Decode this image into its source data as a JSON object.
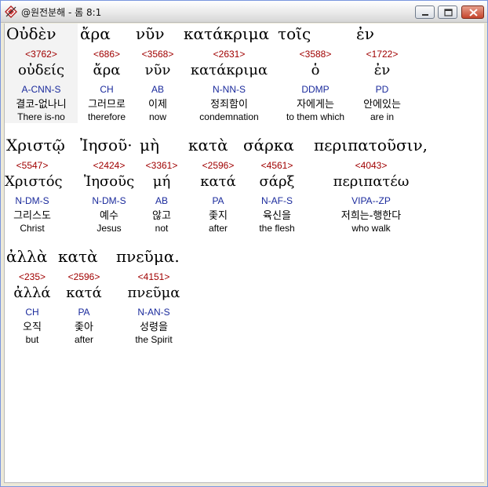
{
  "window": {
    "title": "@원전분해 - 롬 8:1",
    "icon": "app-logo-icon",
    "buttons": [
      "minimize-icon",
      "maximize-icon",
      "close-icon"
    ]
  },
  "words": [
    {
      "greek": "Οὐδὲν",
      "strong": "<3762>",
      "lemma": "οὐδείς",
      "morph": "A-CNN-S",
      "korean": "결코-없나니",
      "english": "There is-no"
    },
    {
      "greek": "ἄρα",
      "strong": "<686>",
      "lemma": "ἄρα",
      "morph": "CH",
      "korean": "그러므로",
      "english": "therefore"
    },
    {
      "greek": "νῦν",
      "strong": "<3568>",
      "lemma": "νῦν",
      "morph": "AB",
      "korean": "이제",
      "english": "now"
    },
    {
      "greek": "κατάκριμα",
      "strong": "<2631>",
      "lemma": "κατάκριμα",
      "morph": "N-NN-S",
      "korean": "정죄함이",
      "english": "condemnation"
    },
    {
      "greek": "τοῖς",
      "strong": "<3588>",
      "lemma": "ὁ",
      "morph": "DDMP",
      "korean": "자에게는",
      "english": "to them which"
    },
    {
      "greek": "ἐν",
      "strong": "<1722>",
      "lemma": "ἐν",
      "morph": "PD",
      "korean": "안에있는",
      "english": "are in"
    },
    {
      "greek": "Χριστῷ",
      "strong": "<5547>",
      "lemma": "Χριστός",
      "morph": "N-DM-S",
      "korean": "그리스도",
      "english": "Christ"
    },
    {
      "greek": "Ἰησοῦ·",
      "strong": "<2424>",
      "lemma": "Ἰησοῦς",
      "morph": "N-DM-S",
      "korean": "예수",
      "english": "Jesus"
    },
    {
      "greek": "μὴ",
      "strong": "<3361>",
      "lemma": "μή",
      "morph": "AB",
      "korean": "않고",
      "english": "not"
    },
    {
      "greek": "κατὰ",
      "strong": "<2596>",
      "lemma": "κατά",
      "morph": "PA",
      "korean": "좇지",
      "english": "after"
    },
    {
      "greek": "σάρκα",
      "strong": "<4561>",
      "lemma": "σάρξ",
      "morph": "N-AF-S",
      "korean": "육신을",
      "english": "the flesh"
    },
    {
      "greek": "περιπατοῦσιν,",
      "strong": "<4043>",
      "lemma": "περιπατέω",
      "morph": "VIPA--ZP",
      "korean": "저희는-행한다",
      "english": "who walk"
    },
    {
      "greek": "ἀλλὰ",
      "strong": "<235>",
      "lemma": "ἀλλά",
      "morph": "CH",
      "korean": "오직",
      "english": "but"
    },
    {
      "greek": "κατὰ",
      "strong": "<2596>",
      "lemma": "κατά",
      "morph": "PA",
      "korean": "좇아",
      "english": "after"
    },
    {
      "greek": "πνεῦμα.",
      "strong": "<4151>",
      "lemma": "πνεῦμα",
      "morph": "N-AN-S",
      "korean": "성령을",
      "english": "the Spirit"
    }
  ]
}
